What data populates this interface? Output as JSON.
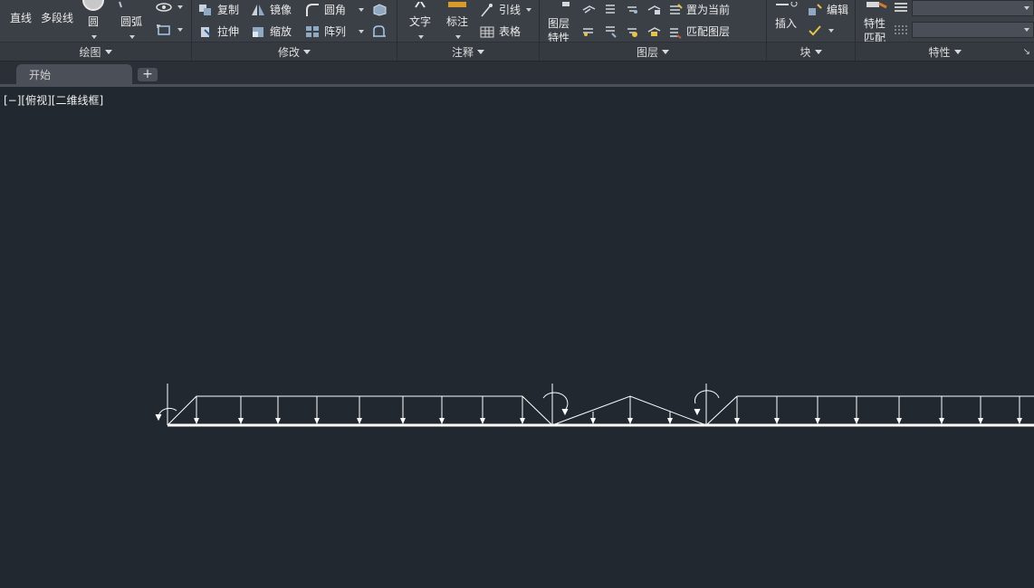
{
  "ribbon": {
    "draw": {
      "title": "绘图",
      "line": "直线",
      "polyline": "多段线",
      "circle": "圆",
      "arc": "圆弧"
    },
    "modify": {
      "title": "修改",
      "copy": "复制",
      "mirror": "镜像",
      "fillet": "圆角",
      "stretch": "拉伸",
      "scale": "缩放",
      "array": "阵列"
    },
    "annotation": {
      "title": "注释",
      "text": "文字",
      "dimension": "标注",
      "leader": "引线",
      "table": "表格"
    },
    "layers": {
      "title": "图层",
      "layer_properties_line1": "图层",
      "layer_properties_line2": "特性",
      "set_current": "置为当前",
      "match_layer": "匹配图层"
    },
    "block": {
      "title": "块",
      "insert": "插入",
      "edit": "编辑"
    },
    "properties": {
      "title": "特性",
      "match_line1": "特性",
      "match_line2": "匹配"
    }
  },
  "tabs": {
    "start": "开始",
    "add": "+"
  },
  "viewport": {
    "label": "[−][俯视][二维线框]"
  },
  "colors": {
    "canvas": "#212830",
    "ribbon": "#3b4047",
    "lines": "#ffffff"
  }
}
